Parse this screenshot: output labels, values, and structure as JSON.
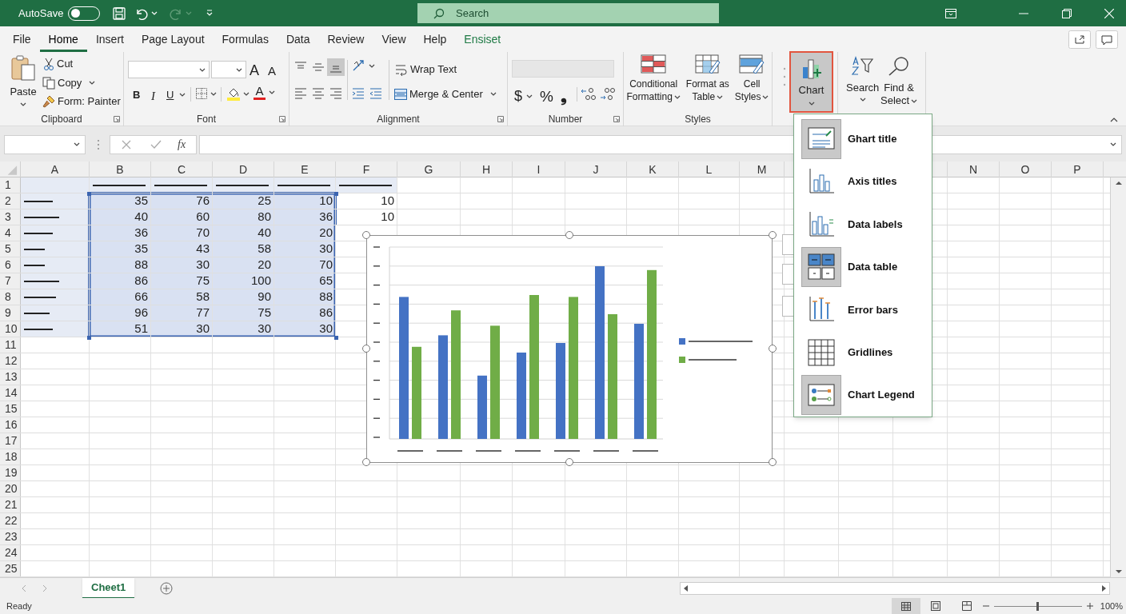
{
  "title_bar": {
    "autosave_label": "AutoSave",
    "autosave_on": false,
    "search_placeholder": "Search"
  },
  "tabs": [
    {
      "label": "File",
      "selected": false,
      "kind": "normal"
    },
    {
      "label": "Home",
      "selected": true,
      "kind": "normal"
    },
    {
      "label": "Insert",
      "selected": false,
      "kind": "normal"
    },
    {
      "label": "Page Layout",
      "selected": false,
      "kind": "normal"
    },
    {
      "label": "Formulas",
      "selected": false,
      "kind": "normal"
    },
    {
      "label": "Data",
      "selected": false,
      "kind": "normal"
    },
    {
      "label": "Review",
      "selected": false,
      "kind": "normal"
    },
    {
      "label": "View",
      "selected": false,
      "kind": "normal"
    },
    {
      "label": "Help",
      "selected": false,
      "kind": "normal"
    },
    {
      "label": "Ensiset",
      "selected": false,
      "kind": "contextual"
    }
  ],
  "ribbon": {
    "clipboard": {
      "label": "Clipboard",
      "paste": "Paste",
      "cut": "Cut",
      "copy": "Copy",
      "format_painter": "Form: Painter"
    },
    "font": {
      "label": "Font",
      "bold": "B",
      "italic": "I",
      "underline": "U",
      "grow": "A",
      "shrink": "A",
      "font_color": "A"
    },
    "alignment": {
      "label": "Alignment",
      "wrap_text": "Wrap Text",
      "merge_center": "Merge & Center",
      "vertical": [
        {
          "selected": false
        },
        {
          "selected": false
        },
        {
          "selected": true
        }
      ]
    },
    "number": {
      "label": "Number",
      "currency": "$",
      "percent": "%",
      "comma": "❟"
    },
    "styles": {
      "label": "Styles",
      "buttons": [
        {
          "lines": [
            "Conditional",
            "Formatting"
          ]
        },
        {
          "lines": [
            "Format as",
            "Table"
          ]
        },
        {
          "lines": [
            "Cell",
            "Styles"
          ]
        }
      ]
    },
    "chart": {
      "label": "Chart",
      "selected": true
    },
    "editing": {
      "buttons": [
        {
          "lines": [
            "Search"
          ]
        },
        {
          "lines": [
            "Find &",
            "Select"
          ]
        }
      ]
    }
  },
  "formula_bar": {
    "fx": "fx"
  },
  "columns": [
    "A",
    "B",
    "C",
    "D",
    "E",
    "F",
    "G",
    "H",
    "I",
    "J",
    "K",
    "L",
    "M",
    "N",
    "O",
    "P"
  ],
  "rows": [
    {
      "label": "1",
      "cells": [
        {
          "kind": "blank",
          "shaded": true,
          "selected": false
        },
        {
          "kind": "dash",
          "shaded": true,
          "selected": false
        },
        {
          "kind": "dash",
          "shaded": true,
          "selected": false
        },
        {
          "kind": "dash",
          "shaded": true,
          "selected": false
        },
        {
          "kind": "dash",
          "shaded": true,
          "selected": false
        },
        {
          "kind": "dash",
          "shaded": true,
          "selected": false
        }
      ]
    },
    {
      "label": "2",
      "cells": [
        {
          "kind": "dash",
          "shaded": true,
          "selected": false
        },
        {
          "kind": "number",
          "text": "35",
          "shaded": true,
          "selected": true
        },
        {
          "kind": "number",
          "text": "76",
          "shaded": true,
          "selected": true
        },
        {
          "kind": "number",
          "text": "25",
          "shaded": true,
          "selected": true
        },
        {
          "kind": "number",
          "text": "10",
          "shaded": true,
          "selected": true
        },
        {
          "kind": "number",
          "text": "10",
          "shaded": false,
          "selected": false
        }
      ]
    },
    {
      "label": "3",
      "cells": [
        {
          "kind": "dash",
          "shaded": true,
          "selected": false
        },
        {
          "kind": "number",
          "text": "40",
          "shaded": true,
          "selected": true
        },
        {
          "kind": "number",
          "text": "60",
          "shaded": true,
          "selected": true
        },
        {
          "kind": "number",
          "text": "80",
          "shaded": true,
          "selected": true
        },
        {
          "kind": "number",
          "text": "36",
          "shaded": true,
          "selected": true
        },
        {
          "kind": "number",
          "text": "10",
          "shaded": false,
          "selected": false
        }
      ]
    },
    {
      "label": "4",
      "cells": [
        {
          "kind": "dash",
          "shaded": true,
          "selected": false
        },
        {
          "kind": "number",
          "text": "36",
          "shaded": true,
          "selected": true
        },
        {
          "kind": "number",
          "text": "70",
          "shaded": true,
          "selected": true
        },
        {
          "kind": "number",
          "text": "40",
          "shaded": true,
          "selected": true
        },
        {
          "kind": "number",
          "text": "20",
          "shaded": true,
          "selected": true
        }
      ]
    },
    {
      "label": "5",
      "cells": [
        {
          "kind": "dash",
          "shaded": true,
          "selected": false
        },
        {
          "kind": "number",
          "text": "35",
          "shaded": true,
          "selected": true
        },
        {
          "kind": "number",
          "text": "43",
          "shaded": true,
          "selected": true
        },
        {
          "kind": "number",
          "text": "58",
          "shaded": true,
          "selected": true
        },
        {
          "kind": "number",
          "text": "30",
          "shaded": true,
          "selected": true
        }
      ]
    },
    {
      "label": "6",
      "cells": [
        {
          "kind": "dash",
          "shaded": true,
          "selected": false
        },
        {
          "kind": "number",
          "text": "88",
          "shaded": true,
          "selected": true
        },
        {
          "kind": "number",
          "text": "30",
          "shaded": true,
          "selected": true
        },
        {
          "kind": "number",
          "text": "20",
          "shaded": true,
          "selected": true
        },
        {
          "kind": "number",
          "text": "70",
          "shaded": true,
          "selected": true
        }
      ]
    },
    {
      "label": "7",
      "cells": [
        {
          "kind": "dash",
          "shaded": true,
          "selected": false
        },
        {
          "kind": "number",
          "text": "86",
          "shaded": true,
          "selected": true
        },
        {
          "kind": "number",
          "text": "75",
          "shaded": true,
          "selected": true
        },
        {
          "kind": "number",
          "text": "100",
          "shaded": true,
          "selected": true
        },
        {
          "kind": "number",
          "text": "65",
          "shaded": true,
          "selected": true
        }
      ]
    },
    {
      "label": "8",
      "cells": [
        {
          "kind": "dash",
          "shaded": true,
          "selected": false
        },
        {
          "kind": "number",
          "text": "66",
          "shaded": true,
          "selected": true
        },
        {
          "kind": "number",
          "text": "58",
          "shaded": true,
          "selected": true
        },
        {
          "kind": "number",
          "text": "90",
          "shaded": true,
          "selected": true
        },
        {
          "kind": "number",
          "text": "88",
          "shaded": true,
          "selected": true
        }
      ]
    },
    {
      "label": "9",
      "cells": [
        {
          "kind": "dash",
          "shaded": true,
          "selected": false
        },
        {
          "kind": "number",
          "text": "96",
          "shaded": true,
          "selected": true
        },
        {
          "kind": "number",
          "text": "77",
          "shaded": true,
          "selected": true
        },
        {
          "kind": "number",
          "text": "75",
          "shaded": true,
          "selected": true
        },
        {
          "kind": "number",
          "text": "86",
          "shaded": true,
          "selected": true
        }
      ]
    },
    {
      "label": "10",
      "cells": [
        {
          "kind": "dash",
          "shaded": true,
          "selected": false
        },
        {
          "kind": "number",
          "text": "51",
          "shaded": true,
          "selected": true
        },
        {
          "kind": "number",
          "text": "30",
          "shaded": true,
          "selected": true
        },
        {
          "kind": "number",
          "text": "30",
          "shaded": true,
          "selected": true
        },
        {
          "kind": "number",
          "text": "30",
          "shaded": true,
          "selected": true
        }
      ]
    },
    {
      "label": "11"
    },
    {
      "label": "12"
    },
    {
      "label": "13"
    },
    {
      "label": "14"
    },
    {
      "label": "15"
    },
    {
      "label": "16"
    },
    {
      "label": "17"
    },
    {
      "label": "18"
    },
    {
      "label": "19"
    },
    {
      "label": "20"
    },
    {
      "label": "21"
    },
    {
      "label": "22"
    },
    {
      "label": "23"
    },
    {
      "label": "24"
    },
    {
      "label": "25"
    }
  ],
  "chart": {
    "legend": [
      {
        "color": "#4472c4"
      },
      {
        "color": "#70ad47"
      }
    ]
  },
  "chart_menu": [
    {
      "label": "Ghart title",
      "selected": true,
      "kind": "title"
    },
    {
      "label": "Axis titles",
      "selected": false,
      "kind": "axis"
    },
    {
      "label": "Data labels",
      "selected": false,
      "kind": "labels"
    },
    {
      "label": "Data table",
      "selected": true,
      "kind": "table"
    },
    {
      "label": "Error bars",
      "selected": false,
      "kind": "error"
    },
    {
      "label": "Gridlines",
      "selected": false,
      "kind": "grid"
    },
    {
      "label": "Chart Legend",
      "selected": true,
      "kind": "legend"
    }
  ],
  "sheets": [
    {
      "label": "Cheet1",
      "selected": true
    }
  ],
  "status_bar": {
    "text": "Ready",
    "zoom": "100%",
    "zoom_slider": {
      "level": 0.5
    }
  }
}
